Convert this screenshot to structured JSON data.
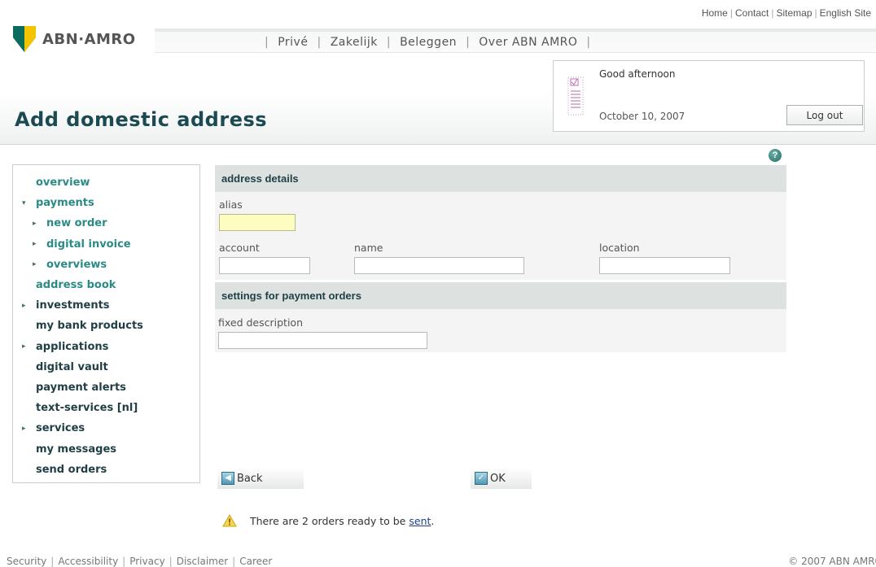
{
  "top_links": [
    "Home",
    "Contact",
    "Sitemap",
    "English Site"
  ],
  "brand": {
    "name": "ABN·AMRO",
    "colors": {
      "green": "#0b6b5c",
      "yellow": "#f5c400"
    }
  },
  "nav": [
    "Privé",
    "Zakelijk",
    "Beleggen",
    "Over ABN AMRO"
  ],
  "page_title": "Add domestic address",
  "greeting": {
    "text": "Good afternoon",
    "date": "October 10, 2007",
    "logout_label": "Log out"
  },
  "sidebar": {
    "items": [
      {
        "label": "overview",
        "level": 0,
        "arrow": "",
        "teal": true
      },
      {
        "label": "payments",
        "level": 0,
        "arrow": "▾",
        "teal": true
      },
      {
        "label": "new order",
        "level": 1,
        "arrow": "▸",
        "teal": true
      },
      {
        "label": "digital invoice",
        "level": 1,
        "arrow": "▸",
        "teal": true
      },
      {
        "label": "overviews",
        "level": 1,
        "arrow": "▸",
        "teal": true
      },
      {
        "label": "address book",
        "level": 0,
        "arrow": "",
        "teal": true
      },
      {
        "label": "investments",
        "level": 0,
        "arrow": "▸",
        "teal": false
      },
      {
        "label": "my bank products",
        "level": 0,
        "arrow": "",
        "teal": false
      },
      {
        "label": "applications",
        "level": 0,
        "arrow": "▸",
        "teal": false
      },
      {
        "label": "digital vault",
        "level": 0,
        "arrow": "",
        "teal": false
      },
      {
        "label": "payment alerts",
        "level": 0,
        "arrow": "",
        "teal": false
      },
      {
        "label": "text-services [nl]",
        "level": 0,
        "arrow": "",
        "teal": false
      },
      {
        "label": "services",
        "level": 0,
        "arrow": "▸",
        "teal": false
      },
      {
        "label": "my messages",
        "level": 0,
        "arrow": "",
        "teal": false
      },
      {
        "label": "send orders",
        "level": 0,
        "arrow": "",
        "teal": false
      }
    ]
  },
  "address_section": {
    "title": "address details",
    "alias_label": "alias",
    "alias_value": "",
    "account_label": "account",
    "account_value": "",
    "name_label": "name",
    "name_value": "",
    "location_label": "location",
    "location_value": ""
  },
  "settings_section": {
    "title": "settings for payment orders",
    "fixed_desc_label": "fixed description",
    "fixed_desc_value": ""
  },
  "buttons": {
    "back": "Back",
    "ok": "OK"
  },
  "notice": {
    "text": "There are 2 orders ready to be",
    "link": "sent",
    "suffix": "."
  },
  "footer": {
    "links": [
      "Security",
      "Accessibility",
      "Privacy",
      "Disclaimer",
      "Career"
    ],
    "copyright": "© 2007 ABN AMRO"
  }
}
